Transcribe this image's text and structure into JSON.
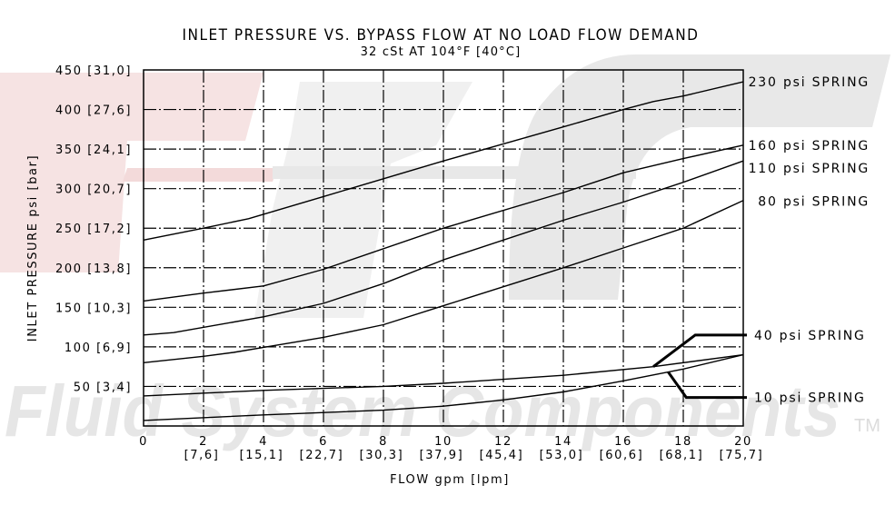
{
  "chart_data": {
    "type": "line",
    "title": "INLET PRESSURE VS. BYPASS FLOW AT NO LOAD FLOW DEMAND",
    "subtitle": "32 cSt AT 104°F [40°C]",
    "xlabel": "FLOW gpm [lpm]",
    "ylabel": "INLET PRESSURE psi [bar]",
    "xlim": [
      0,
      20
    ],
    "ylim": [
      0,
      450
    ],
    "grid": true,
    "grid_style": "dash-dot",
    "x_ticks": [
      {
        "value": 0,
        "label": "0",
        "sublabel": ""
      },
      {
        "value": 2,
        "label": "2",
        "sublabel": "[7,6]"
      },
      {
        "value": 4,
        "label": "4",
        "sublabel": "[15,1]"
      },
      {
        "value": 6,
        "label": "6",
        "sublabel": "[22,7]"
      },
      {
        "value": 8,
        "label": "8",
        "sublabel": "[30,3]"
      },
      {
        "value": 10,
        "label": "10",
        "sublabel": "[37,9]"
      },
      {
        "value": 12,
        "label": "12",
        "sublabel": "[45,4]"
      },
      {
        "value": 14,
        "label": "14",
        "sublabel": "[53,0]"
      },
      {
        "value": 16,
        "label": "16",
        "sublabel": "[60,6]"
      },
      {
        "value": 18,
        "label": "18",
        "sublabel": "[68,1]"
      },
      {
        "value": 20,
        "label": "20",
        "sublabel": "[75,7]"
      }
    ],
    "y_ticks": [
      {
        "value": 50,
        "label": "50 [3,4]"
      },
      {
        "value": 100,
        "label": "100 [6,9]"
      },
      {
        "value": 150,
        "label": "150 [10,3]"
      },
      {
        "value": 200,
        "label": "200 [13,8]"
      },
      {
        "value": 250,
        "label": "250 [17,2]"
      },
      {
        "value": 300,
        "label": "300 [20,7]"
      },
      {
        "value": 350,
        "label": "350 [24,1]"
      },
      {
        "value": 400,
        "label": "400 [27,6]"
      },
      {
        "value": 450,
        "label": "450 [31,0]"
      }
    ],
    "series": [
      {
        "name": "230 psi SPRING",
        "label_y": 435,
        "x": [
          0,
          2,
          3.5,
          6,
          10,
          14,
          16,
          17,
          18,
          20
        ],
        "y": [
          235,
          250,
          262,
          290,
          335,
          378,
          400,
          410,
          417,
          435
        ]
      },
      {
        "name": "160 psi SPRING",
        "label_y": 355,
        "x": [
          0,
          2,
          4,
          6,
          10,
          14,
          16,
          18,
          20
        ],
        "y": [
          158,
          168,
          177,
          198,
          250,
          295,
          320,
          338,
          355
        ]
      },
      {
        "name": "110 psi SPRING",
        "label_y": 326,
        "x": [
          0,
          1,
          4,
          6,
          8,
          10,
          14,
          16,
          18,
          20
        ],
        "y": [
          115,
          118,
          138,
          155,
          180,
          210,
          260,
          283,
          308,
          335
        ]
      },
      {
        "name": "80 psi SPRING",
        "label_y": 284,
        "x": [
          0,
          2,
          3,
          6,
          8,
          10,
          14,
          16,
          18,
          20
        ],
        "y": [
          80,
          88,
          93,
          112,
          128,
          152,
          200,
          225,
          250,
          285
        ]
      },
      {
        "name": "40 psi SPRING",
        "label_y": 115,
        "leader": {
          "from_x": 17,
          "from_y": 75,
          "elbow_x": 18.4,
          "elbow_y": 115
        },
        "x": [
          0,
          4,
          8,
          10,
          14,
          17,
          20
        ],
        "y": [
          38,
          45,
          50,
          54,
          64,
          75,
          90
        ]
      },
      {
        "name": "10 psi SPRING",
        "label_y": 36,
        "leader": {
          "from_x": 17.5,
          "from_y": 68,
          "elbow_x": 18.1,
          "elbow_y": 36
        },
        "x": [
          0,
          4,
          8,
          10,
          12,
          14,
          16,
          18,
          20
        ],
        "y": [
          7,
          14,
          20,
          25,
          33,
          43,
          57,
          72,
          90
        ]
      }
    ]
  },
  "watermark": {
    "text": "Fluid System Components",
    "trademark": "TM",
    "colors": {
      "red": "#f3dcdc",
      "gray": "#e6e6e6"
    }
  }
}
